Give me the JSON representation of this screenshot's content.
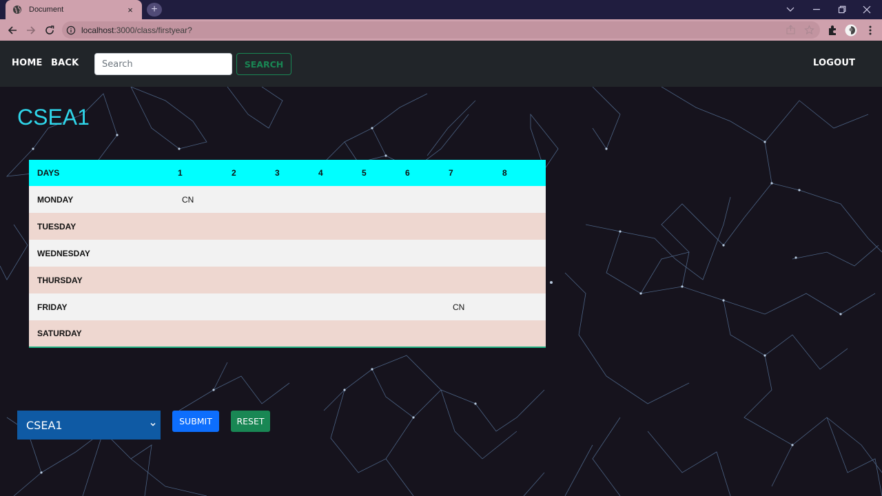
{
  "browser": {
    "tab_title": "Document",
    "tab_close": "×",
    "new_tab": "+",
    "url_host": "localhost",
    "url_path": ":3000/class/firstyear?",
    "icons": [
      "globe-icon",
      "back-icon",
      "forward-icon",
      "reload-icon",
      "info-icon",
      "share-icon",
      "star-icon",
      "extensions-icon",
      "profile-icon",
      "menu-icon",
      "minimize-icon",
      "maximize-icon",
      "close-icon",
      "chevron-down-icon"
    ]
  },
  "nav": {
    "home": "HOME",
    "back": "BACK",
    "search_placeholder": "Search",
    "search_button": "SEARCH",
    "logout": "LOGOUT"
  },
  "page": {
    "title": "CSEA1"
  },
  "timetable": {
    "headers": [
      "DAYS",
      "1",
      "2",
      "3",
      "4",
      "5",
      "6",
      "7",
      "8"
    ],
    "rows": [
      {
        "day": "MONDAY",
        "cells": [
          "CN",
          "",
          "",
          "",
          "",
          "",
          "",
          ""
        ]
      },
      {
        "day": "TUESDAY",
        "cells": [
          "",
          "",
          "",
          "",
          "",
          "",
          "",
          ""
        ]
      },
      {
        "day": "WEDNESDAY",
        "cells": [
          "",
          "",
          "",
          "",
          "",
          "",
          "",
          ""
        ]
      },
      {
        "day": "THURSDAY",
        "cells": [
          "",
          "",
          "",
          "",
          "",
          "",
          "",
          ""
        ]
      },
      {
        "day": "FRIDAY",
        "cells": [
          "",
          "",
          "",
          "",
          "",
          "",
          "CN",
          ""
        ]
      },
      {
        "day": "SATURDAY",
        "cells": [
          "",
          "",
          "",
          "",
          "",
          "",
          "",
          ""
        ]
      }
    ]
  },
  "form": {
    "class_selected": "CSEA1",
    "submit": "SUBMIT",
    "reset": "RESET"
  },
  "colors": {
    "header_cyan": "#00ffff",
    "title_cyan": "#2fd6ea",
    "select_blue": "#0f5aa4",
    "submit_blue": "#0d6efd",
    "reset_green": "#198754"
  }
}
